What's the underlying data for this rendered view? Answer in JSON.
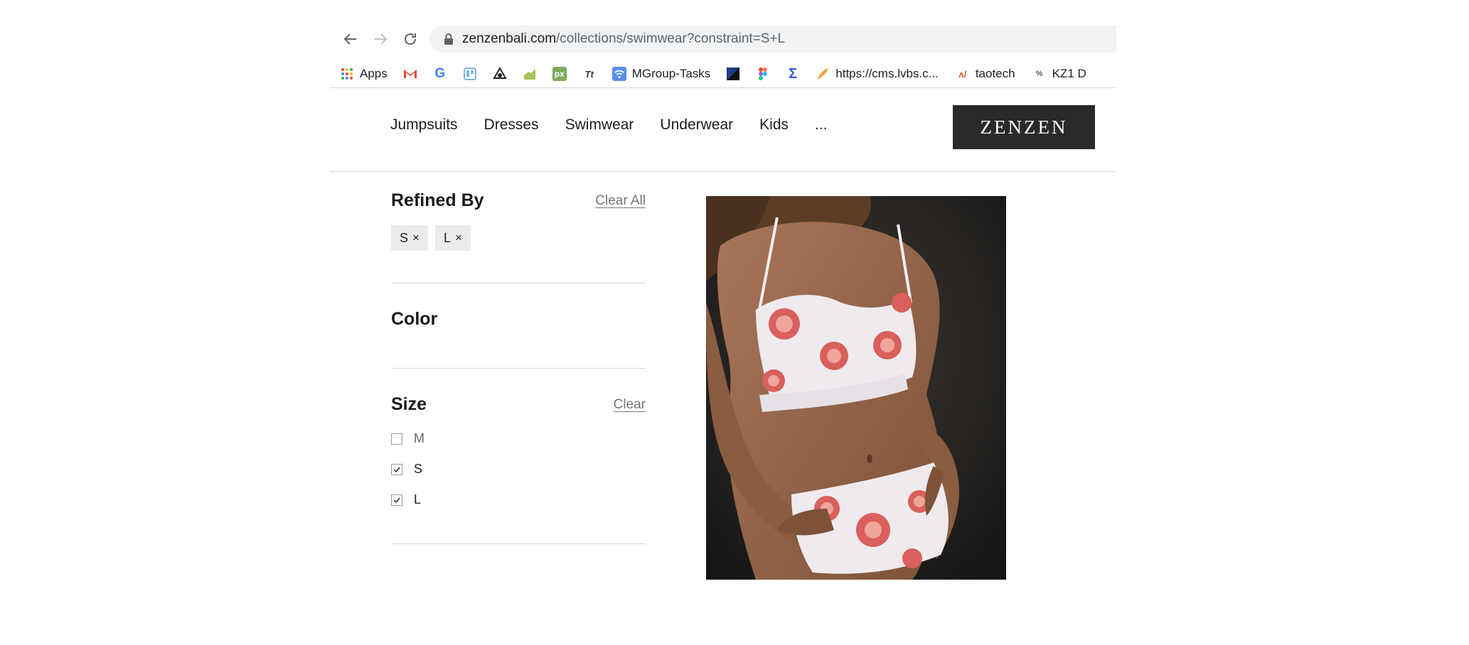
{
  "browser": {
    "url_domain": "zenzenbali.com",
    "url_path": "/collections/swimwear?constraint=S+L",
    "bookmarks": [
      {
        "icon": "apps-grid-icon",
        "label": "Apps"
      },
      {
        "icon": "gmail-icon",
        "label": ""
      },
      {
        "icon": "google-icon",
        "label": ""
      },
      {
        "icon": "trello-icon",
        "label": ""
      },
      {
        "icon": "eye-logo-icon",
        "label": ""
      },
      {
        "icon": "chart-green-icon",
        "label": ""
      },
      {
        "icon": "px-icon",
        "label": ""
      },
      {
        "icon": "tt-icon",
        "label": ""
      },
      {
        "icon": "wifi-icon",
        "label": "MGroup-Tasks"
      },
      {
        "icon": "square-blue-icon",
        "label": ""
      },
      {
        "icon": "figma-icon",
        "label": ""
      },
      {
        "icon": "sigma-icon",
        "label": ""
      },
      {
        "icon": "feather-icon",
        "label": "https://cms.lvbs.c..."
      },
      {
        "icon": "taotech-icon",
        "label": "taotech"
      },
      {
        "icon": "kz1-icon",
        "label": "KZ1 D"
      }
    ]
  },
  "site": {
    "menu": [
      "Jumpsuits",
      "Dresses",
      "Swimwear",
      "Underwear",
      "Kids",
      "..."
    ],
    "logo": "ZENZEN"
  },
  "filters": {
    "refined_title": "Refined By",
    "clear_all": "Clear All",
    "chips": [
      {
        "label": "S",
        "remove": "×"
      },
      {
        "label": "L",
        "remove": "×"
      }
    ],
    "color_title": "Color",
    "size_title": "Size",
    "size_clear": "Clear",
    "sizes": [
      {
        "label": "M",
        "checked": false
      },
      {
        "label": "S",
        "checked": true
      },
      {
        "label": "L",
        "checked": true
      }
    ]
  },
  "colors": {
    "logo_bg": "#2a2a2a",
    "chip_bg": "#ececec",
    "fig_pink": "#d9605c"
  }
}
